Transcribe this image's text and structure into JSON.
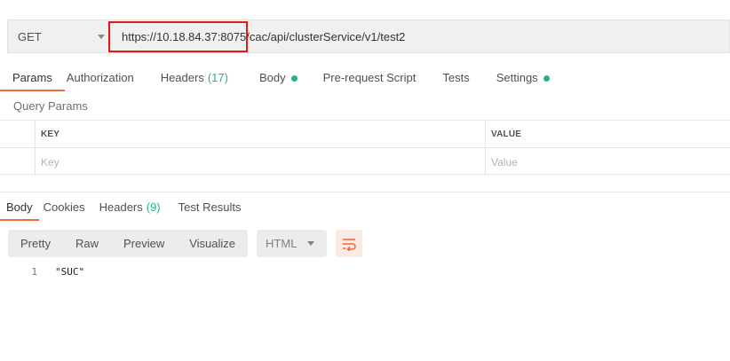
{
  "request": {
    "method": "GET",
    "url": "https://10.18.84.37:8075/cac/api/clusterService/v1/test2"
  },
  "request_tabs": [
    {
      "label": "Params",
      "active": true
    },
    {
      "label": "Authorization"
    },
    {
      "label": "Headers",
      "count": "(17)"
    },
    {
      "label": "Body",
      "dot": true
    },
    {
      "label": "Pre-request Script"
    },
    {
      "label": "Tests"
    },
    {
      "label": "Settings",
      "dot": true
    }
  ],
  "query_params": {
    "title": "Query Params",
    "col_key": "KEY",
    "col_value": "VALUE",
    "key_placeholder": "Key",
    "value_placeholder": "Value"
  },
  "response_tabs": [
    {
      "label": "Body",
      "active": true
    },
    {
      "label": "Cookies"
    },
    {
      "label": "Headers",
      "count": "(9)"
    },
    {
      "label": "Test Results"
    }
  ],
  "response_toolbar": {
    "views": [
      "Pretty",
      "Raw",
      "Preview",
      "Visualize"
    ],
    "format": "HTML"
  },
  "response_body": {
    "lines": [
      {
        "no": "1",
        "text": "\"SUC\""
      }
    ]
  },
  "colors": {
    "accent": "#f26b3a",
    "status_green": "#26b47f",
    "highlight_red": "#e0191b"
  }
}
